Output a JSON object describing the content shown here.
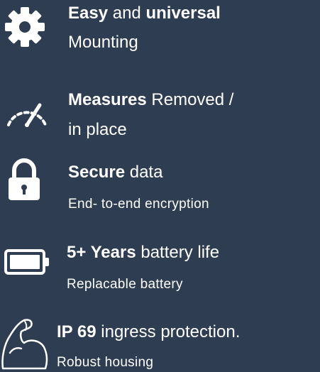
{
  "features": [
    {
      "icon": "gear-icon",
      "bold": "Easy",
      "rest": " and ",
      "bold2": "universal",
      "line2": "Mounting"
    },
    {
      "icon": "speedometer-icon",
      "bold": "Measures",
      "rest": " Removed /",
      "line2": "in place"
    },
    {
      "icon": "lock-icon",
      "bold": "Secure",
      "rest": " data",
      "sub": "End- to-end encryption"
    },
    {
      "icon": "battery-icon",
      "bold": "5+ Years",
      "rest": " battery life",
      "sub": "Replacable battery"
    },
    {
      "icon": "flexed-arm-icon",
      "bold": "IP 69",
      "rest": " ingress protection.",
      "sub": "Robust housing"
    }
  ],
  "colors": {
    "background": "#2e3d52",
    "foreground": "#ffffff"
  }
}
